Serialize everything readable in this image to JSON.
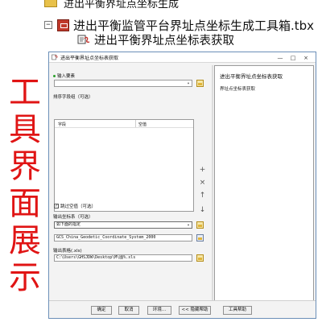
{
  "tree": {
    "parent_label": "进出平衡界址点坐标生成",
    "toolbox_label": "进出平衡监管平台界址点坐标生成工具箱.tbx",
    "tool_label": "进出平衡界址点坐标表获取"
  },
  "side_label": [
    "工",
    "具",
    "界",
    "面",
    "展",
    "示"
  ],
  "dialog": {
    "title": "进出平衡界址点坐标表获取",
    "window_buttons": [
      "—",
      "□",
      "×"
    ],
    "input_elements_label": "输入要素",
    "input_elements_value": "",
    "sort_field_label": "排序字段组（可选）",
    "table_headers": [
      "字段",
      "空值"
    ],
    "side_tools": [
      "+",
      "×",
      "↑",
      "↓"
    ],
    "skip_null_label": "跳过空值（可选）",
    "skip_null_checked": true,
    "output_cs_label": "输出坐标系（可选）",
    "output_cs_mode": "如下面的指定",
    "output_cs_value": "GCS_China_Geodetic_Coordinate_System_2000",
    "output_table_label": "输出表格(.xls)",
    "output_table_value": "C:\\Users\\GHSJDW\\Desktop\\M\\图%.xls",
    "help_title": "进出平衡界址点坐标表获取",
    "help_text": "界址点坐标表获取",
    "buttons": {
      "ok": "确定",
      "cancel": "取消",
      "env": "环境...",
      "hide_help": "<< 隐藏帮助",
      "tool_help": "工具帮助"
    }
  },
  "colors": {
    "side_label": "#e01414",
    "dialog_border": "#6b8fb8"
  }
}
